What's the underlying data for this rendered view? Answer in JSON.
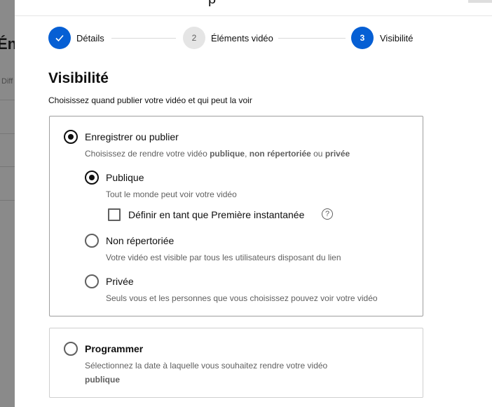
{
  "background": {
    "title_fragment": "Éne",
    "tab_fragment": "Diff"
  },
  "header": {
    "fragment": "p"
  },
  "stepper": {
    "steps": [
      {
        "number": "✓",
        "label": "Détails",
        "state": "done"
      },
      {
        "number": "2",
        "label": "Éléments vidéo",
        "state": "todo"
      },
      {
        "number": "3",
        "label": "Visibilité",
        "state": "active"
      }
    ]
  },
  "page": {
    "title": "Visibilité",
    "subtitle": "Choisissez quand publier votre vidéo et qui peut la voir"
  },
  "save_publish": {
    "label": "Enregistrer ou publier",
    "description_prefix": "Choisissez de rendre votre vidéo ",
    "description_public": "publique",
    "description_sep": ", ",
    "description_unlisted": "non répertoriée",
    "description_or": " ou ",
    "description_private": "privée",
    "options": [
      {
        "label": "Publique",
        "description": "Tout le monde peut voir votre vidéo",
        "selected": true
      },
      {
        "label": "Non répertoriée",
        "description": "Votre vidéo est visible par tous les utilisateurs disposant du lien",
        "selected": false
      },
      {
        "label": "Privée",
        "description": "Seuls vous et les personnes que vous choisissez pouvez voir votre vidéo",
        "selected": false
      }
    ],
    "premiere_label": "Définir en tant que Première instantanée",
    "help_glyph": "?"
  },
  "schedule": {
    "label": "Programmer",
    "description_line1": "Sélectionnez la date à laquelle vous souhaitez rendre votre vidéo",
    "description_line2": "publique"
  },
  "colors": {
    "accent": "#065fd4",
    "text": "#0f0f0f",
    "secondary_text": "#606060"
  }
}
